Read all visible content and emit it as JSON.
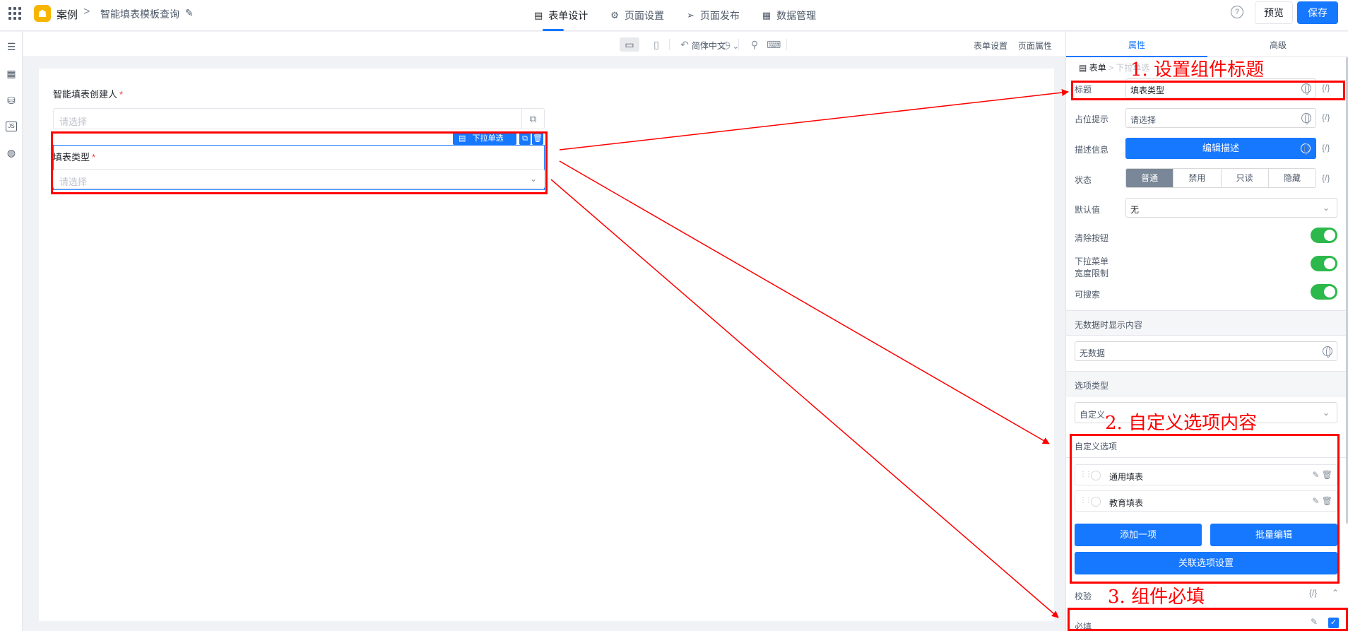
{
  "topbar": {
    "app_name": "案例",
    "breadcrumb_sep": ">",
    "page_name": "智能填表模板查询",
    "tabs": [
      {
        "label": "表单设计",
        "icon": "file-icon"
      },
      {
        "label": "页面设置",
        "icon": "gear-icon"
      },
      {
        "label": "页面发布",
        "icon": "send-icon"
      },
      {
        "label": "数据管理",
        "icon": "table-icon"
      }
    ],
    "help_icon": "?",
    "preview_label": "预览",
    "save_label": "保存",
    "accent_color": "#1677ff"
  },
  "canvas_toolbar": {
    "language": "简体中文",
    "form_settings": "表单设置",
    "page_props": "页面属性"
  },
  "canvas": {
    "field1": {
      "label": "智能填表创建人",
      "required_mark": "*",
      "placeholder": "请选择"
    },
    "field2": {
      "label": "填表类型",
      "required_mark": "*",
      "placeholder": "请选择",
      "component_tag": "下拉单选"
    }
  },
  "panel": {
    "tab_props": "属性",
    "tab_advanced": "高级",
    "crumb_form": "表单",
    "crumb_component": "下拉单选",
    "title_label": "标题",
    "title_value": "填表类型",
    "placeholder_label": "占位提示",
    "placeholder_value": "请选择",
    "desc_label": "描述信息",
    "desc_button": "编辑描述",
    "status_label": "状态",
    "status_options": [
      "普通",
      "禁用",
      "只读",
      "隐藏"
    ],
    "default_label": "默认值",
    "default_value": "无",
    "clear_label": "清除按钮",
    "width_limit_label1": "下拉菜单",
    "width_limit_label2": "宽度限制",
    "searchable_label": "可搜索",
    "nodata_section": "无数据时显示内容",
    "nodata_value": "无数据",
    "option_type_section": "选项类型",
    "option_type_value": "自定义",
    "custom_options_section": "自定义选项",
    "options": [
      "通用填表",
      "教育填表"
    ],
    "add_button": "添加一项",
    "batch_button": "批量编辑",
    "link_button": "关联选项设置",
    "validate_label": "校验",
    "required_label": "必填",
    "fx": "{/}"
  },
  "annotations": {
    "step1": "1. 设置组件标题",
    "step2": "2. 自定义选项内容",
    "step3": "3. 组件必填",
    "color": "#ff0000"
  }
}
